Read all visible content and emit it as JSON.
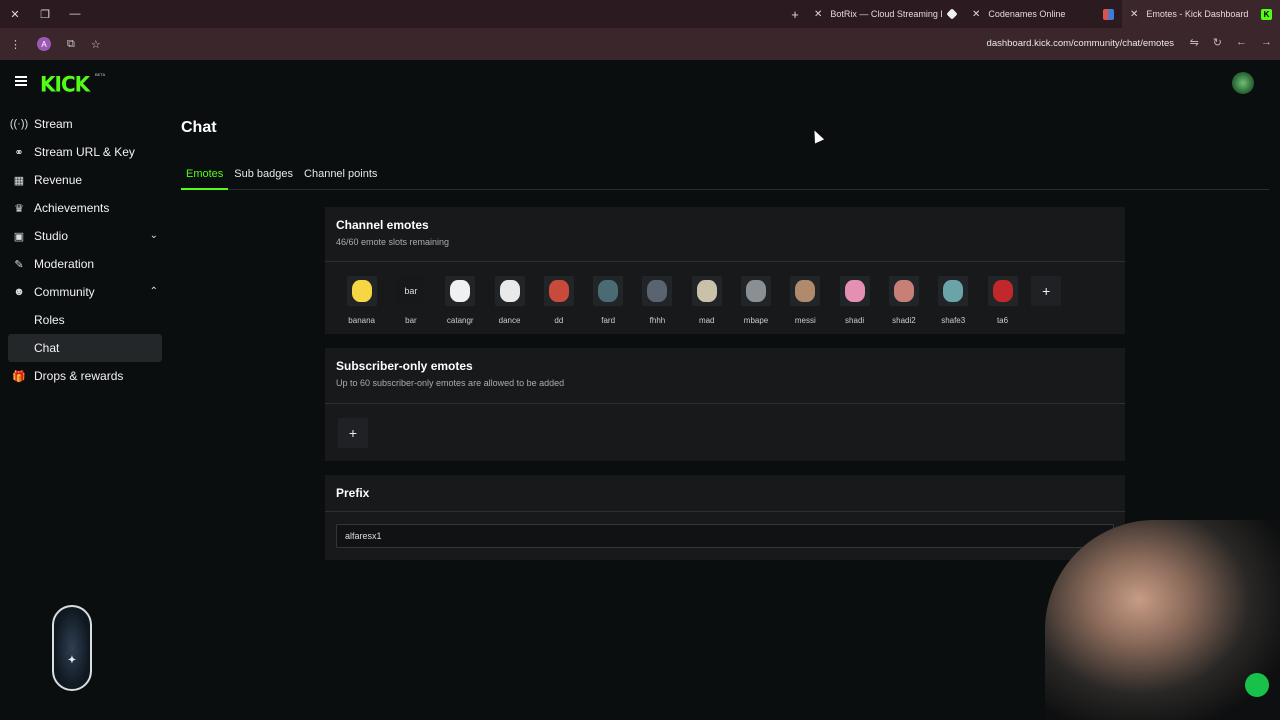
{
  "browser": {
    "tabs": [
      {
        "title": "BotRix — Cloud Streaming Bot",
        "fav_color": "#f1f1f1"
      },
      {
        "title": "Codenames Online",
        "fav_color": "#d9534f"
      },
      {
        "title": "Emotes - Kick Dashboard",
        "fav_color": "#53fc18",
        "active": true
      }
    ],
    "url": "dashboard.kick.com/community/chat/emotes",
    "avatar_letter": "A"
  },
  "header": {
    "logo": "KICK",
    "beta": "BETA"
  },
  "sidebar": {
    "items": [
      {
        "label": "Stream",
        "icon": "broadcast-icon",
        "glyph": "(·)"
      },
      {
        "label": "Stream URL & Key",
        "icon": "link-icon",
        "glyph": "🔗"
      },
      {
        "label": "Revenue",
        "icon": "chart-icon",
        "glyph": "▤"
      },
      {
        "label": "Achievements",
        "icon": "trophy-icon",
        "glyph": "🏆"
      },
      {
        "label": "Studio",
        "icon": "video-icon",
        "glyph": "▣",
        "expand": "collapsed"
      },
      {
        "label": "Moderation",
        "icon": "wrench-icon",
        "glyph": "🔧"
      },
      {
        "label": "Community",
        "icon": "users-icon",
        "glyph": "👥",
        "expand": "expanded"
      }
    ],
    "community_sub": [
      "Roles",
      "Chat"
    ],
    "drops_label": "Drops & rewards"
  },
  "main": {
    "title": "Chat",
    "tabs": [
      "Emotes",
      "Sub badges",
      "Channel points"
    ],
    "channel_emotes": {
      "title": "Channel emotes",
      "subtitle": "46/60 emote slots remaining",
      "emotes": [
        "banana",
        "bar",
        "catangr",
        "dance",
        "dd",
        "fard",
        "fhhh",
        "mad",
        "mbape",
        "messi",
        "shadi",
        "shadi2",
        "shafe3",
        "ta6"
      ],
      "broken_alt": "bar"
    },
    "subscriber_emotes": {
      "title": "Subscriber-only emotes",
      "subtitle": "Up to 60 subscriber-only emotes are allowed to be added"
    },
    "prefix": {
      "title": "Prefix",
      "value": "alfaresx1"
    }
  }
}
